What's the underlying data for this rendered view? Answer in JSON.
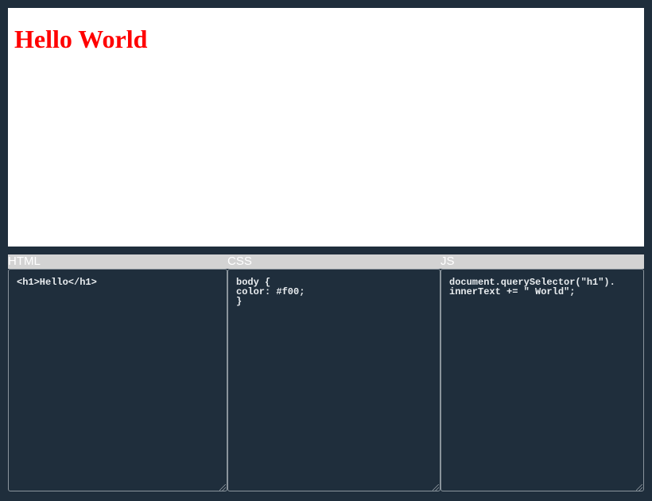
{
  "preview": {
    "heading": "Hello World",
    "heading_color": "#ff0000"
  },
  "editors": {
    "html": {
      "label": "HTML",
      "code": "<h1>Hello</h1>"
    },
    "css": {
      "label": "CSS",
      "code": "body {\ncolor: #f00;\n}"
    },
    "js": {
      "label": "JS",
      "code": "document.querySelector(\"h1\").\ninnerText += \" World\";"
    }
  },
  "colors": {
    "background": "#1f2e3c",
    "label_bar": "#d3d3d3",
    "preview_bg": "#ffffff"
  }
}
